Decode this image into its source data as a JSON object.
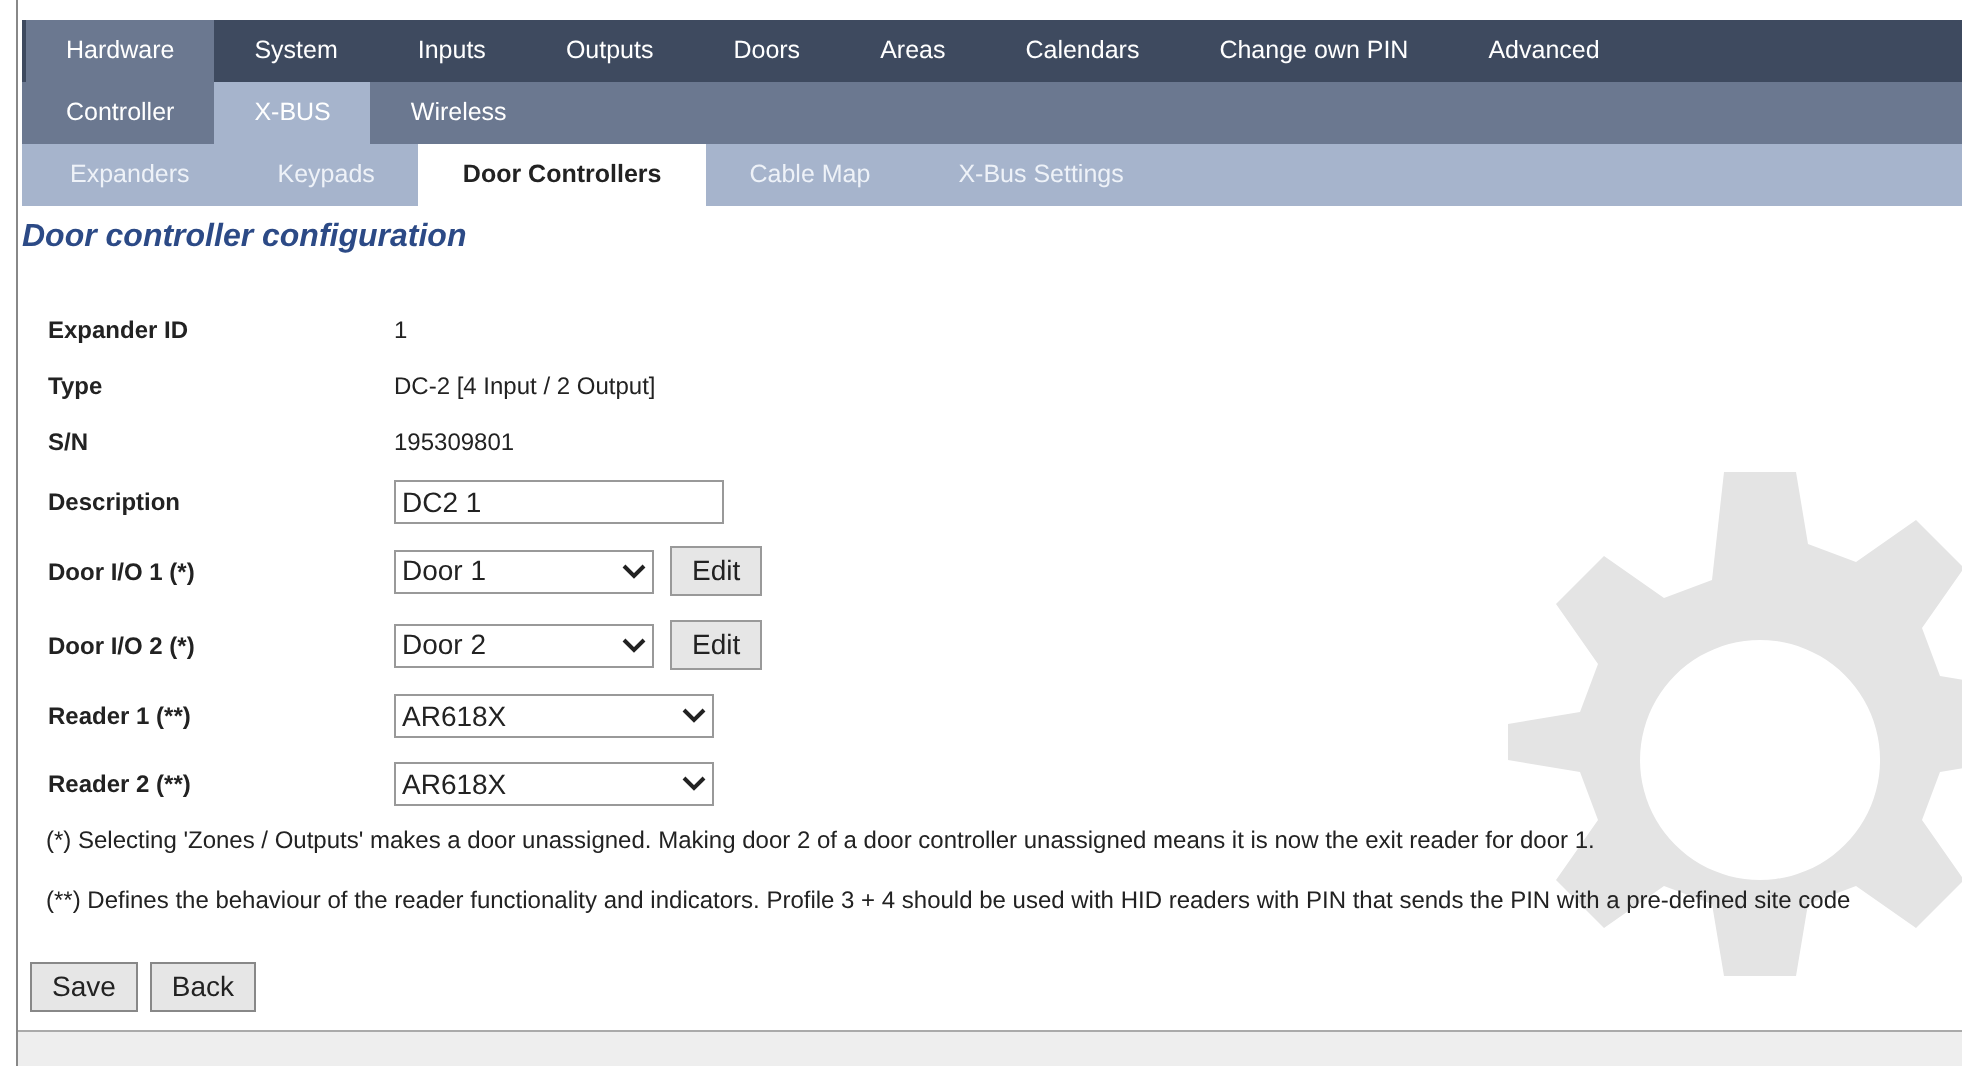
{
  "menu_tabs": [
    {
      "label": "Hardware",
      "selected": true
    },
    {
      "label": "System",
      "selected": false
    },
    {
      "label": "Inputs",
      "selected": false
    },
    {
      "label": "Outputs",
      "selected": false
    },
    {
      "label": "Doors",
      "selected": false
    },
    {
      "label": "Areas",
      "selected": false
    },
    {
      "label": "Calendars",
      "selected": false
    },
    {
      "label": "Change own PIN",
      "selected": false
    },
    {
      "label": "Advanced",
      "selected": false
    }
  ],
  "sub_tabs": [
    {
      "label": "Controller",
      "selected": false
    },
    {
      "label": "X-BUS",
      "selected": true
    },
    {
      "label": "Wireless",
      "selected": false
    }
  ],
  "section_tabs": [
    {
      "label": "Expanders",
      "selected": false
    },
    {
      "label": "Keypads",
      "selected": false
    },
    {
      "label": "Door Controllers",
      "selected": true
    },
    {
      "label": "Cable Map",
      "selected": false
    },
    {
      "label": "X-Bus Settings",
      "selected": false
    }
  ],
  "heading": "Door controller configuration",
  "fields": [
    {
      "kind": "text",
      "label": "Expander ID",
      "value": "1"
    },
    {
      "kind": "text",
      "label": "Type",
      "value": "DC-2 [4 Input / 2 Output]"
    },
    {
      "kind": "text",
      "label": "S/N",
      "value": "195309801"
    },
    {
      "kind": "input",
      "label": "Description",
      "value": "DC2 1"
    },
    {
      "kind": "select_edit",
      "label": "Door I/O 1 (*)",
      "value": "Door 1",
      "button": "Edit"
    },
    {
      "kind": "select_edit",
      "label": "Door I/O 2 (*)",
      "value": "Door 2",
      "button": "Edit"
    },
    {
      "kind": "select",
      "label": "Reader 1 (**)",
      "value": "AR618X"
    },
    {
      "kind": "select",
      "label": "Reader 2 (**)",
      "value": "AR618X"
    }
  ],
  "notes": [
    "(*) Selecting 'Zones / Outputs' makes a door unassigned. Making door 2 of a door controller unassigned means it is now the exit reader for door 1.",
    "(**) Defines the behaviour of the reader functionality and indicators. Profile 3 + 4 should be used with HID readers with PIN that sends the PIN with a pre-defined site code"
  ],
  "buttons": [
    "Save",
    "Back"
  ]
}
